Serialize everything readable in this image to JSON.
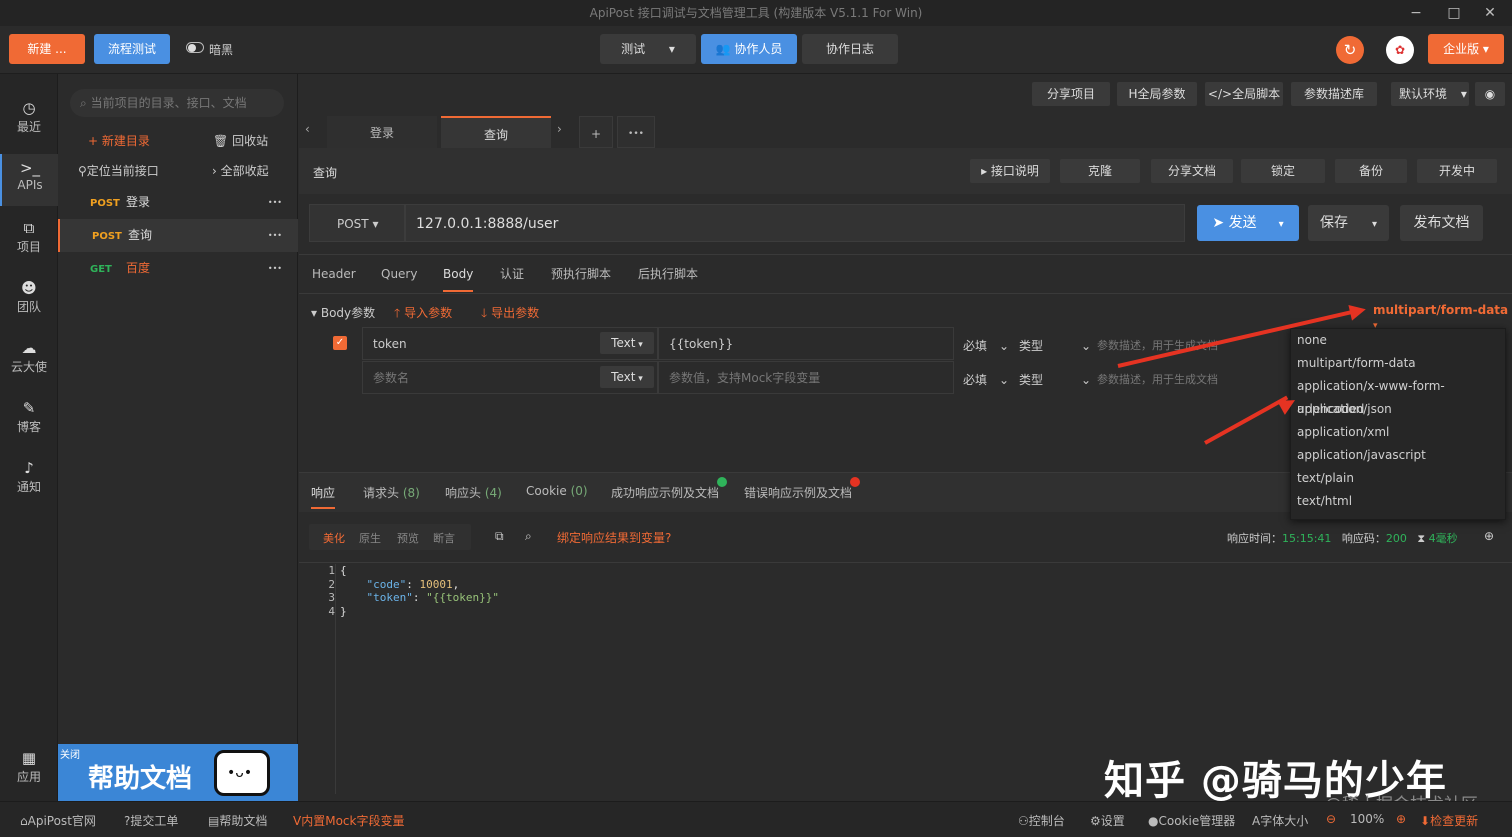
{
  "titlebar": {
    "title": "ApiPost 接口调试与文档管理工具 (构建版本 V5.1.1 For Win)",
    "min": "−",
    "max": "□",
    "close": "✕"
  },
  "topbar": {
    "new_label": "新建 ...",
    "flow_label": "流程测试",
    "theme_label": "暗黑",
    "env_label": "测试",
    "collab_label": "协作人员",
    "log_label": "协作日志",
    "edition_label": "企业版"
  },
  "leftnav": [
    {
      "icon": "clock-icon",
      "glyph": "◷",
      "label": "最近"
    },
    {
      "icon": "terminal-icon",
      "glyph": ">_",
      "label": "APIs"
    },
    {
      "icon": "project-icon",
      "glyph": "⧉",
      "label": "项目"
    },
    {
      "icon": "team-icon",
      "glyph": "☻",
      "label": "团队"
    },
    {
      "icon": "cloud-icon",
      "glyph": "☁",
      "label": "云大使"
    },
    {
      "icon": "edit-icon",
      "glyph": "✎",
      "label": "博客"
    },
    {
      "icon": "bell-icon",
      "glyph": "♪",
      "label": "通知"
    },
    {
      "icon": "apps-icon",
      "glyph": "▦",
      "label": "应用"
    }
  ],
  "tree": {
    "search_placeholder": "当前项目的目录、接口、文档",
    "new_dir": "+ 新建目录",
    "recycle": "回收站",
    "locate": "定位当前接口",
    "collapse": "› 全部收起",
    "items": [
      {
        "method": "POST",
        "name": "登录",
        "color": "#f0a020"
      },
      {
        "method": "POST",
        "name": "查询",
        "color": "#f0a020"
      },
      {
        "method": "GET",
        "name": "百度",
        "color": "#2fb35a"
      }
    ],
    "more": "•••",
    "banner_close": "关闭",
    "banner_text": "帮助文档"
  },
  "main": {
    "toolbar": [
      "分享项目",
      "H全局参数",
      "</>全局脚本",
      "参数描述库"
    ],
    "env_select": "默认环境",
    "tabs": [
      "登录",
      "查询"
    ],
    "tab_add": "+",
    "tab_more": "•••",
    "page_title": "查询",
    "actions": [
      "▸ 接口说明",
      "克隆",
      "分享文档",
      "锁定",
      "备份",
      "开发中"
    ],
    "method": "POST",
    "url": "127.0.0.1:8888/user",
    "send": "发送",
    "save": "保存",
    "publish": "发布文档",
    "subtabs": [
      "Header",
      "Query",
      "Body",
      "认证",
      "预执行脚本",
      "后执行脚本"
    ],
    "body_params": "Body参数",
    "import": "导入参数",
    "export": "导出参数",
    "content_type": "multipart/form-data",
    "rows": [
      {
        "key": "token",
        "type": "Text",
        "value": "{{token}}",
        "required": "必填",
        "typelabel": "类型",
        "desc": "参数描述，用于生成文档"
      },
      {
        "key": "参数名",
        "type": "Text",
        "value": "参数值，支持Mock字段变量",
        "required": "必填",
        "typelabel": "类型",
        "desc": "参数描述，用于生成文档"
      }
    ],
    "dropdown": [
      "none",
      "multipart/form-data",
      "application/x-www-form-urlencoded",
      "application/json",
      "application/xml",
      "application/javascript",
      "text/plain",
      "text/html"
    ],
    "resp_tabs": [
      "响应",
      "请求头",
      "(8)",
      "响应头",
      "(4)",
      "Cookie",
      "(0)",
      "成功响应示例及文档",
      "错误响应示例及文档"
    ],
    "view_tabs": [
      "美化",
      "原生",
      "预览",
      "断言"
    ],
    "bind_link": "绑定响应结果到变量?",
    "resp_time_label": "响应时间：",
    "resp_time": "15:15:41",
    "resp_code_label": "响应码：",
    "resp_code": "200",
    "resp_ms": "4毫秒",
    "code_lines": [
      "{",
      "    \"code\": 10001,",
      "    \"token\": \"{{token}}\"",
      "}"
    ],
    "line_nums": [
      "1",
      "2",
      "3",
      "4"
    ]
  },
  "watermark": {
    "main": "知乎 @骑马的少年",
    "sub": "@稀土掘金技术社区"
  },
  "statusbar": {
    "items": [
      "ApiPost官网",
      "提交工单",
      "帮助文档",
      "内置Mock字段变量"
    ],
    "right": [
      "控制台",
      "设置",
      "Cookie管理器",
      "字体大小",
      "100%",
      "检查更新"
    ]
  },
  "colors": {
    "accent": "#4a90e2",
    "orange": "#f06a35",
    "red": "#e53322"
  }
}
